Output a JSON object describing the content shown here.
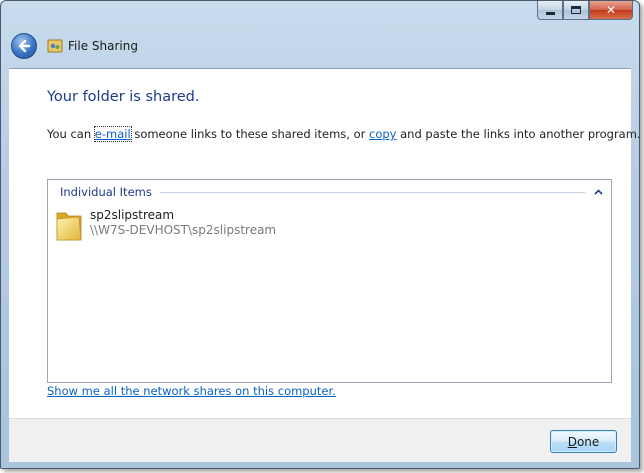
{
  "window": {
    "title": "File Sharing",
    "caption_buttons": {
      "minimize": "minimize-icon",
      "maximize": "maximize-icon",
      "close": "close-icon"
    },
    "close_glyph": "✕"
  },
  "main": {
    "headline": "Your folder is shared.",
    "description": {
      "prefix": "You can ",
      "email_link": "e-mail",
      "middle": " someone links to these shared items, or ",
      "copy_link": "copy",
      "suffix": " and paste the links into another program."
    },
    "group": {
      "title": "Individual Items",
      "items": [
        {
          "name": "sp2slipstream",
          "path": "\\\\W7S-DEVHOST\\sp2slipstream",
          "icon": "folder-icon"
        }
      ]
    },
    "network_shares_link": "Show me all the network shares on this computer."
  },
  "footer": {
    "done_label_underlined": "D",
    "done_label_rest": "one"
  },
  "colors": {
    "headline": "#1c3c8c",
    "link": "#0b60c6",
    "path": "#7a7a7a"
  }
}
